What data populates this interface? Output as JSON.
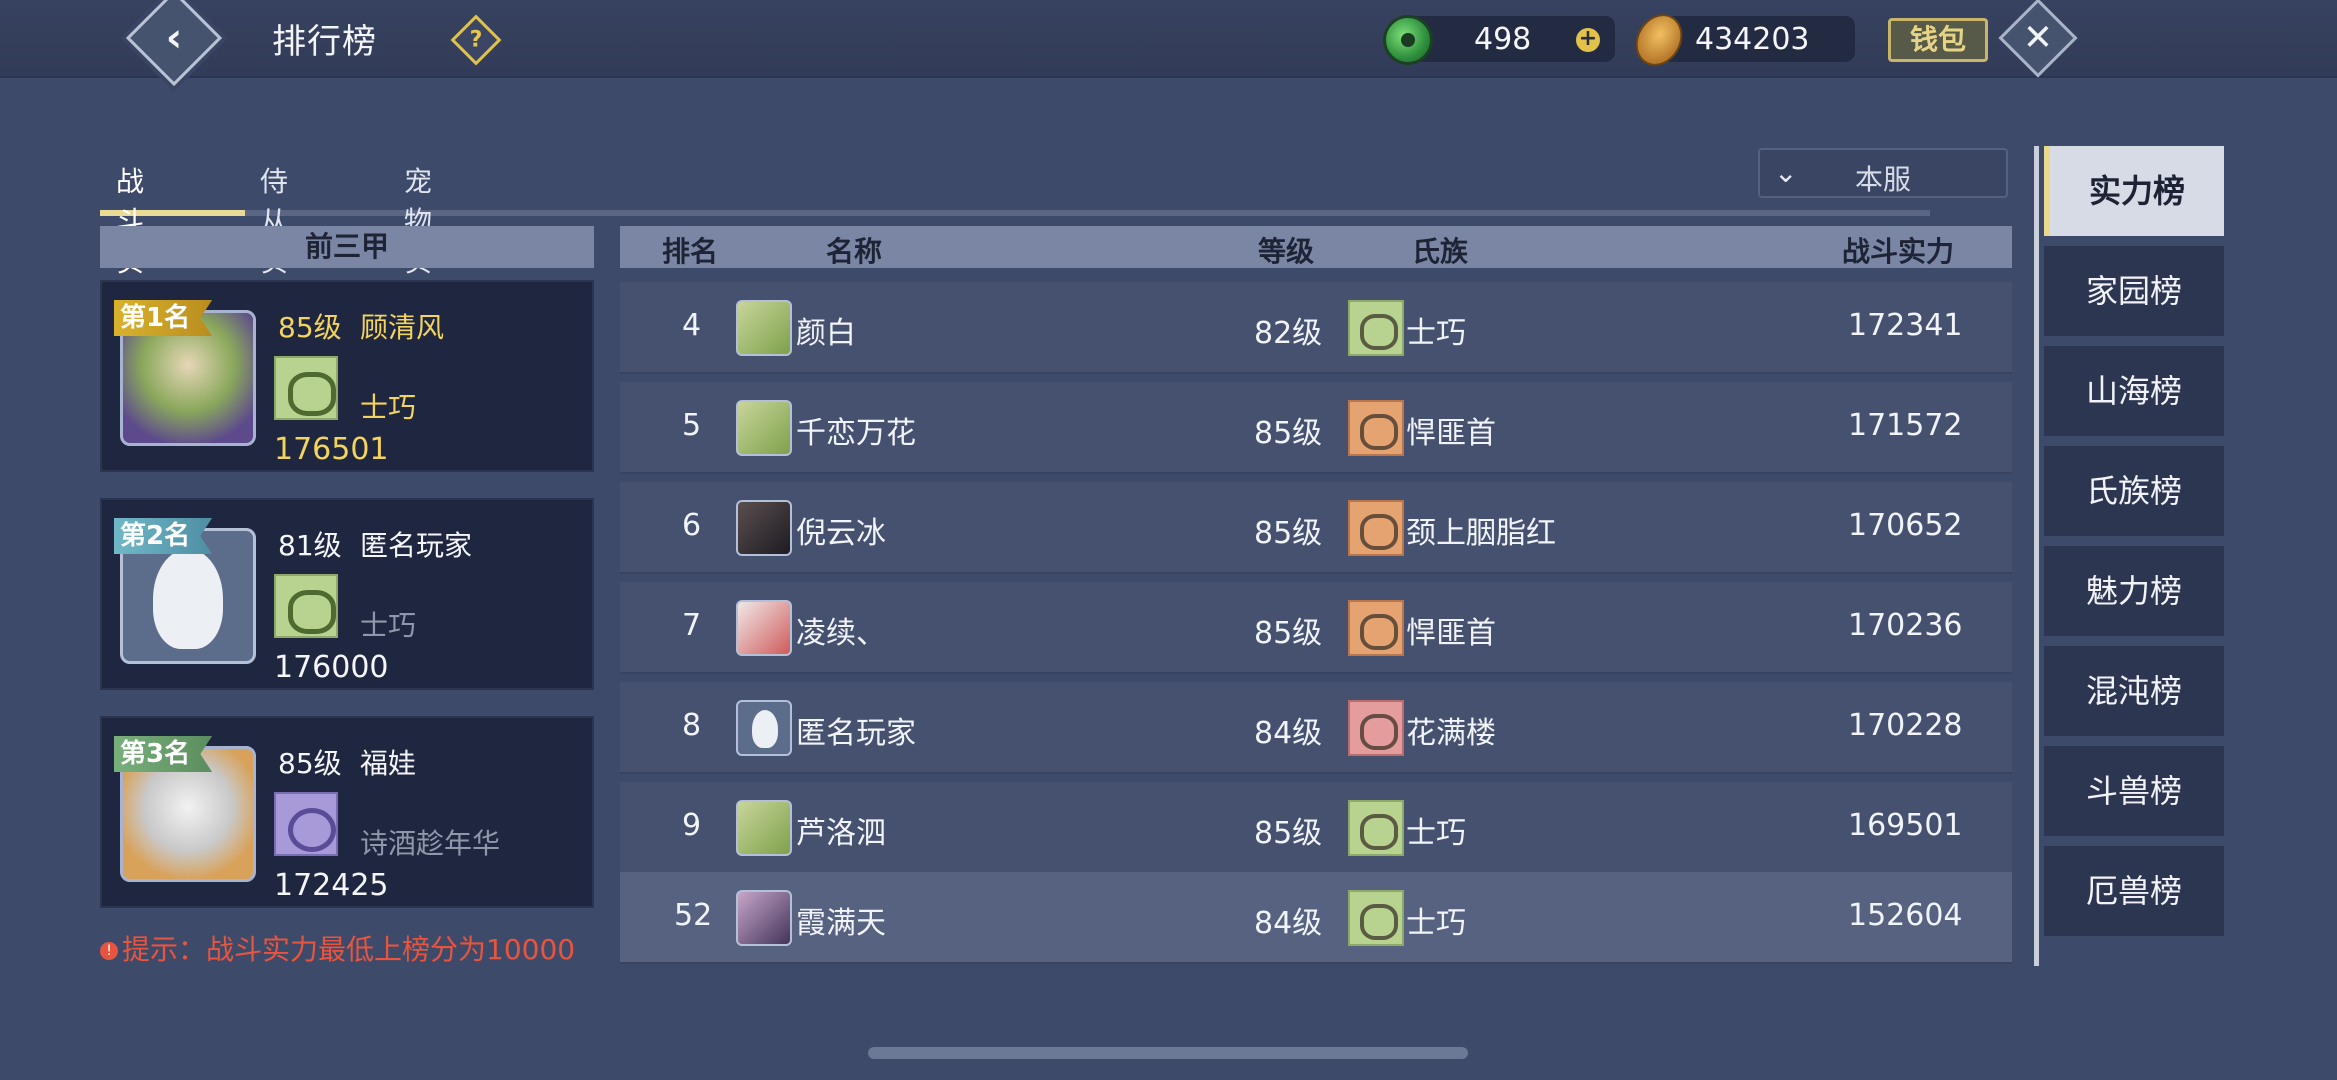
{
  "header": {
    "title": "排行榜",
    "currency_jade": "498",
    "currency_seed": "434203",
    "wallet_label": "钱包"
  },
  "subtabs": [
    "战斗实力",
    "侍从实力",
    "宠物实力"
  ],
  "server_filter": "本服",
  "top3": {
    "header": "前三甲",
    "cards": [
      {
        "rank": "第1名",
        "level": "85级",
        "name": "顾清风",
        "clan": "士巧",
        "power": "176501"
      },
      {
        "rank": "第2名",
        "level": "81级",
        "name": "匿名玩家",
        "clan": "士巧",
        "power": "176000"
      },
      {
        "rank": "第3名",
        "level": "85级",
        "name": "福娃",
        "clan": "诗酒趁年华",
        "power": "172425"
      }
    ]
  },
  "hint": "提示：战斗实力最低上榜分为10000",
  "table": {
    "headers": {
      "rank": "排名",
      "name": "名称",
      "level": "等级",
      "clan": "氏族",
      "power": "战斗实力"
    },
    "rows": [
      {
        "rank": "4",
        "name": "颜白",
        "level": "82级",
        "clan": "士巧",
        "power": "172341"
      },
      {
        "rank": "5",
        "name": "千恋万花",
        "level": "85级",
        "clan": "悍匪首",
        "power": "171572"
      },
      {
        "rank": "6",
        "name": "倪云冰",
        "level": "85级",
        "clan": "颈上胭脂红",
        "power": "170652"
      },
      {
        "rank": "7",
        "name": "凌续、",
        "level": "85级",
        "clan": "悍匪首",
        "power": "170236"
      },
      {
        "rank": "8",
        "name": "匿名玩家",
        "level": "84级",
        "clan": "花满楼",
        "power": "170228"
      },
      {
        "rank": "9",
        "name": "芦洛泗",
        "level": "85级",
        "clan": "士巧",
        "power": "169501"
      }
    ],
    "self_row": {
      "rank": "52",
      "name": "霞满天",
      "level": "84级",
      "clan": "士巧",
      "power": "152604"
    }
  },
  "sidebar": [
    "实力榜",
    "家园榜",
    "山海榜",
    "氏族榜",
    "魅力榜",
    "混沌榜",
    "斗兽榜",
    "厄兽榜"
  ],
  "icons": {
    "back": "back-arrow-icon",
    "help": "help-icon",
    "close": "close-icon",
    "jade": "jade-icon",
    "seed": "seed-icon",
    "dropdown": "chevron-down-icon"
  }
}
